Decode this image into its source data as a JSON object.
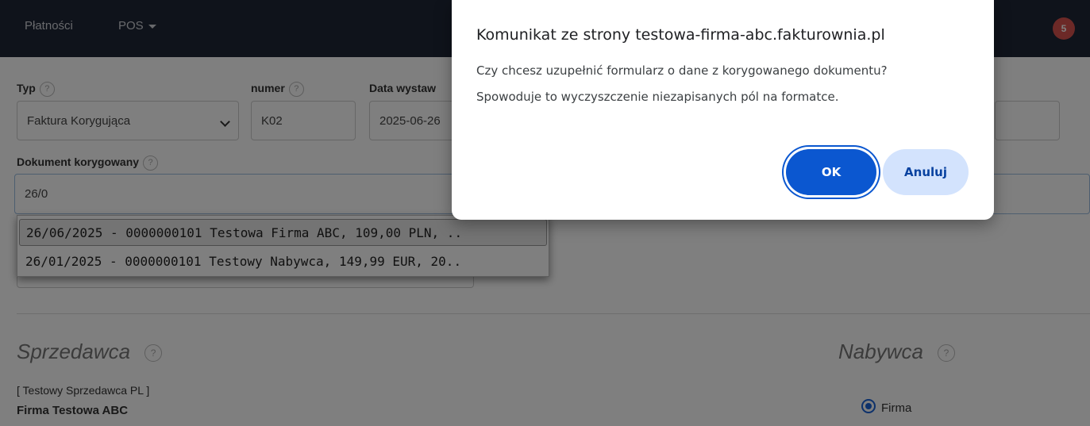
{
  "navbar": {
    "items": [
      {
        "label": "Płatności",
        "dropdown": false
      },
      {
        "label": "POS",
        "dropdown": true
      }
    ],
    "notification_count": "5"
  },
  "form": {
    "typ": {
      "label": "Typ",
      "help": "?",
      "value": "Faktura Korygująca"
    },
    "numer": {
      "label": "numer",
      "help": "?",
      "value": "K02"
    },
    "data_wystawienia": {
      "label": "Data wystaw",
      "value": "2025-06-26"
    },
    "dokument_korygowany": {
      "label": "Dokument korygowany",
      "help": "?",
      "value": "26/0"
    }
  },
  "autocomplete": {
    "items": [
      {
        "text": "26/06/2025 - 0000000101 Testowa Firma ABC, 109,00 PLN, ..",
        "selected": true
      },
      {
        "text": "26/01/2025 - 0000000101 Testowy Nabywca, 149,99 EUR, 20..",
        "selected": false
      }
    ]
  },
  "seller": {
    "title": "Sprzedawca",
    "help": "?",
    "tag": "[ Testowy Sprzedawca PL ]",
    "name": "Firma Testowa ABC"
  },
  "buyer": {
    "title": "Nabywca",
    "help": "?",
    "radio_label": "Firma",
    "radio_checked": true
  },
  "dialog": {
    "title": "Komunikat ze strony testowa-firma-abc.fakturownia.pl",
    "message_line1": "Czy chcesz uzupełnić formularz o dane z korygowanego dokumentu?",
    "message_line2": "Spowoduje to wyczyszczenie niezapisanych pól na formatce.",
    "ok_label": "OK",
    "cancel_label": "Anuluj"
  },
  "colors": {
    "navbar": "#1e2636",
    "ok_button": "#0b57d0",
    "cancel_button": "#d3e3fd",
    "badge": "#d9534f"
  }
}
